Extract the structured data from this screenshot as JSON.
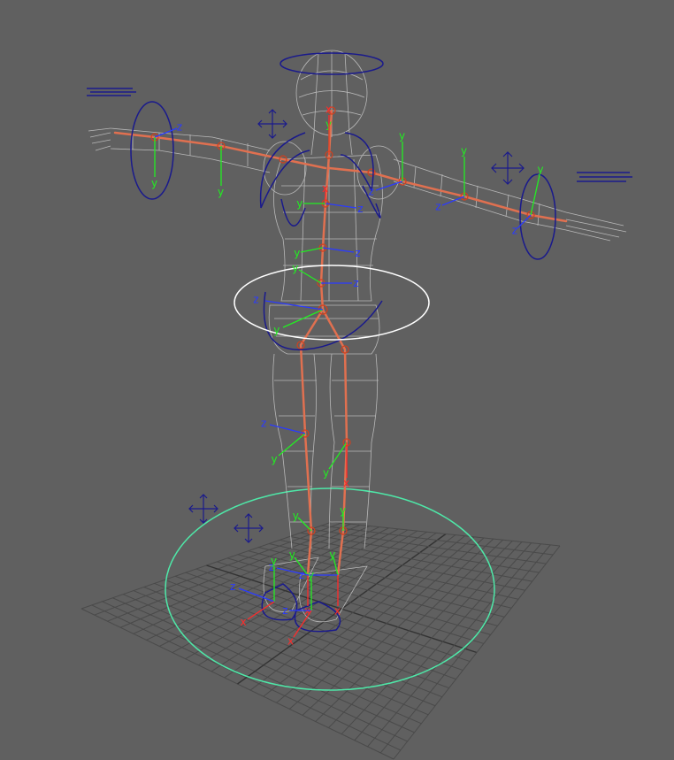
{
  "axis_labels": {
    "x": "x",
    "y": "y",
    "z": "z"
  },
  "colors": {
    "background": "#606060",
    "grid": "#4a4a4a",
    "grid_major": "#333333",
    "mesh": "#c8c8c8",
    "joint": "#d0401e",
    "bone": "#e07050",
    "axis_x": "#ff2a2a",
    "axis_y": "#22ee22",
    "axis_z": "#2a3aff",
    "control": "#1a1a8c",
    "selected": "#ffffff",
    "root_circle": "#4ee8a8"
  }
}
